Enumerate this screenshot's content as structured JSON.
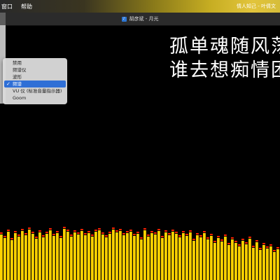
{
  "menubar": {
    "items": [
      "窗口",
      "帮助"
    ],
    "right_text": "情人知己 - 叶倩文"
  },
  "window": {
    "title": "胡彦斌 - 月光",
    "icon": "document-icon"
  },
  "lyrics": {
    "line1": "孤单魂随风荡",
    "line2": "谁去想痴情困"
  },
  "visualization_menu": {
    "items": [
      {
        "label": "禁用",
        "selected": false
      },
      {
        "label": "频谱仪",
        "selected": false
      },
      {
        "label": "波形",
        "selected": false
      },
      {
        "label": "频谱",
        "selected": true
      },
      {
        "label": "VU 仪 (标准音量指示器)",
        "selected": false
      },
      {
        "label": "Goom",
        "selected": false
      }
    ]
  },
  "spectrum": {
    "bar_color": "#ffd200",
    "peak_color": "#ff2200",
    "levels": [
      0.67,
      0.62,
      0.71,
      0.59,
      0.69,
      0.64,
      0.72,
      0.66,
      0.74,
      0.68,
      0.61,
      0.7,
      0.63,
      0.68,
      0.73,
      0.65,
      0.69,
      0.62,
      0.75,
      0.71,
      0.64,
      0.7,
      0.67,
      0.72,
      0.66,
      0.69,
      0.64,
      0.71,
      0.73,
      0.67,
      0.63,
      0.68,
      0.74,
      0.7,
      0.72,
      0.66,
      0.69,
      0.71,
      0.65,
      0.68,
      0.6,
      0.73,
      0.64,
      0.69,
      0.67,
      0.72,
      0.62,
      0.7,
      0.66,
      0.71,
      0.68,
      0.63,
      0.69,
      0.65,
      0.7,
      0.58,
      0.66,
      0.63,
      0.69,
      0.6,
      0.65,
      0.55,
      0.62,
      0.57,
      0.64,
      0.52,
      0.6,
      0.55,
      0.5,
      0.58,
      0.53,
      0.61,
      0.48,
      0.56,
      0.45,
      0.52,
      0.47,
      0.5,
      0.42,
      0.46
    ]
  }
}
